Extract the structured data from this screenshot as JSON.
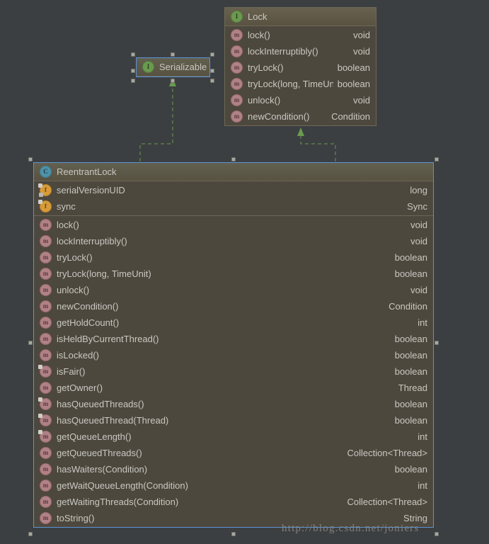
{
  "diagram": {
    "type": "uml-class-diagram",
    "background_color": "#3c3f41",
    "box_fill_color": "#4d483e",
    "relation_color": "#6a9a4f",
    "selection_color": "#5b93d6"
  },
  "lock_class": {
    "name": "Lock",
    "stereotype": "interface",
    "icon": "interface-icon",
    "selected": false,
    "members": [
      {
        "icon": "method-icon",
        "name": "lock()",
        "type": "void"
      },
      {
        "icon": "method-icon",
        "name": "lockInterruptibly()",
        "type": "void"
      },
      {
        "icon": "method-icon",
        "name": "tryLock()",
        "type": "boolean"
      },
      {
        "icon": "method-icon",
        "name": "tryLock(long, TimeUnit)",
        "type": "boolean"
      },
      {
        "icon": "method-icon",
        "name": "unlock()",
        "type": "void"
      },
      {
        "icon": "method-icon",
        "name": "newCondition()",
        "type": "Condition"
      }
    ]
  },
  "serializable_class": {
    "name": "Serializable",
    "stereotype": "interface",
    "icon": "interface-icon",
    "selected": true,
    "members": []
  },
  "reentrantlock_class": {
    "name": "ReentrantLock",
    "stereotype": "class",
    "icon": "class-icon",
    "selected": true,
    "fields": [
      {
        "icon": "field-icon",
        "name": "serialVersionUID",
        "type": "long",
        "badge": "static-final"
      },
      {
        "icon": "field-icon",
        "name": "sync",
        "type": "Sync",
        "badge": "final"
      }
    ],
    "methods": [
      {
        "icon": "method-icon",
        "name": "lock()",
        "type": "void",
        "badge": ""
      },
      {
        "icon": "method-icon",
        "name": "lockInterruptibly()",
        "type": "void",
        "badge": ""
      },
      {
        "icon": "method-icon",
        "name": "tryLock()",
        "type": "boolean",
        "badge": ""
      },
      {
        "icon": "method-icon",
        "name": "tryLock(long, TimeUnit)",
        "type": "boolean",
        "badge": ""
      },
      {
        "icon": "method-icon",
        "name": "unlock()",
        "type": "void",
        "badge": ""
      },
      {
        "icon": "method-icon",
        "name": "newCondition()",
        "type": "Condition",
        "badge": ""
      },
      {
        "icon": "method-icon",
        "name": "getHoldCount()",
        "type": "int",
        "badge": ""
      },
      {
        "icon": "method-icon",
        "name": "isHeldByCurrentThread()",
        "type": "boolean",
        "badge": ""
      },
      {
        "icon": "method-icon",
        "name": "isLocked()",
        "type": "boolean",
        "badge": ""
      },
      {
        "icon": "method-icon",
        "name": "isFair()",
        "type": "boolean",
        "badge": "modifier"
      },
      {
        "icon": "method-icon",
        "name": "getOwner()",
        "type": "Thread",
        "badge": ""
      },
      {
        "icon": "method-icon",
        "name": "hasQueuedThreads()",
        "type": "boolean",
        "badge": "modifier"
      },
      {
        "icon": "method-icon",
        "name": "hasQueuedThread(Thread)",
        "type": "boolean",
        "badge": "modifier"
      },
      {
        "icon": "method-icon",
        "name": "getQueueLength()",
        "type": "int",
        "badge": "modifier"
      },
      {
        "icon": "method-icon",
        "name": "getQueuedThreads()",
        "type": "Collection<Thread>",
        "badge": ""
      },
      {
        "icon": "method-icon",
        "name": "hasWaiters(Condition)",
        "type": "boolean",
        "badge": ""
      },
      {
        "icon": "method-icon",
        "name": "getWaitQueueLength(Condition)",
        "type": "int",
        "badge": ""
      },
      {
        "icon": "method-icon",
        "name": "getWaitingThreads(Condition)",
        "type": "Collection<Thread>",
        "badge": ""
      },
      {
        "icon": "method-icon",
        "name": "toString()",
        "type": "String",
        "badge": ""
      }
    ]
  },
  "relations": [
    {
      "from": "ReentrantLock",
      "to": "Serializable",
      "kind": "realization"
    },
    {
      "from": "ReentrantLock",
      "to": "Lock",
      "kind": "realization"
    }
  ],
  "watermark": {
    "text": "http://blog.csdn.net/joniers"
  }
}
